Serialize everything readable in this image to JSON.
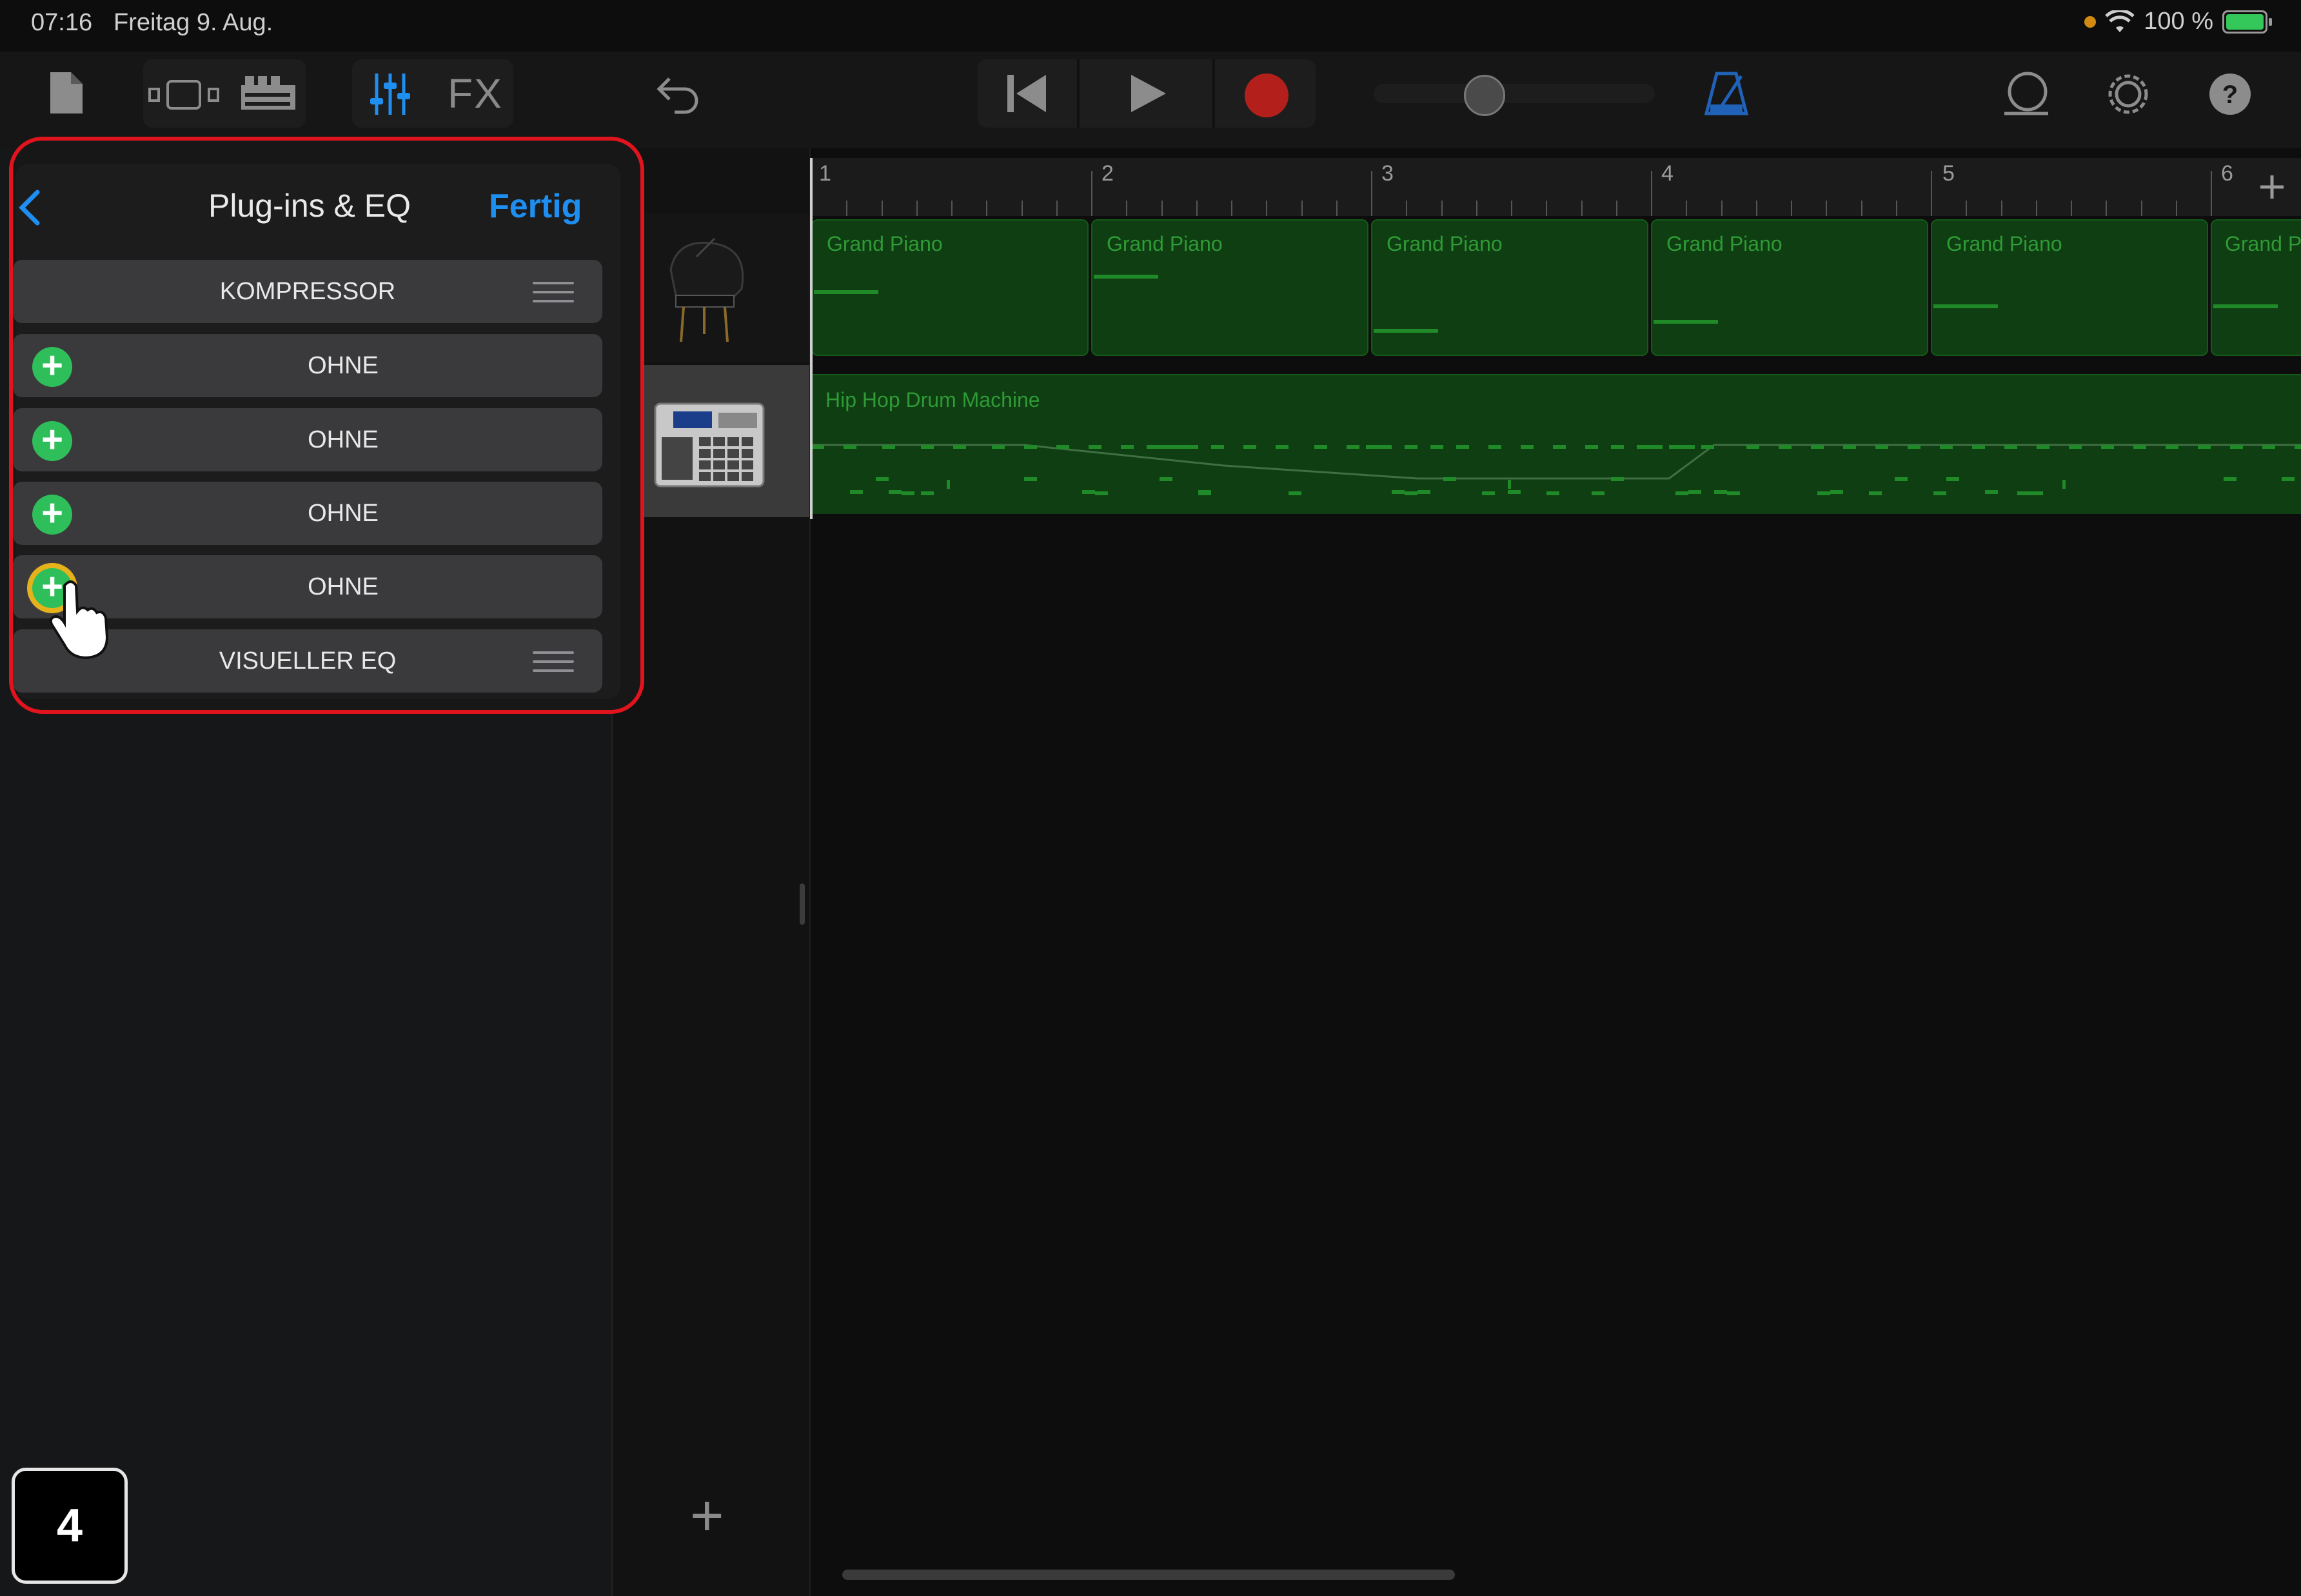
{
  "status_bar": {
    "time": "07:16",
    "date": "Freitag 9. Aug.",
    "battery_text": "100 %"
  },
  "popover": {
    "title": "Plug-ins & EQ",
    "done_label": "Fertig",
    "rows": [
      {
        "label": "KOMPRESSOR",
        "type": "plugin"
      },
      {
        "label": "OHNE",
        "type": "empty"
      },
      {
        "label": "OHNE",
        "type": "empty"
      },
      {
        "label": "OHNE",
        "type": "empty"
      },
      {
        "label": "OHNE",
        "type": "empty"
      },
      {
        "label": "VISUELLER EQ",
        "type": "plugin"
      }
    ]
  },
  "toolbar": {
    "fx_label": "FX"
  },
  "ruler": {
    "bars": [
      "1",
      "2",
      "3",
      "4",
      "5",
      "6"
    ]
  },
  "tracks": [
    {
      "name": "Grand Piano",
      "icon": "grand-piano-icon"
    },
    {
      "name": "Hip Hop Drum Machine",
      "icon": "drum-machine-icon"
    }
  ],
  "piano_regions": [
    {
      "label": "Grand Piano"
    },
    {
      "label": "Grand Piano"
    },
    {
      "label": "Grand Piano"
    },
    {
      "label": "Grand Piano"
    },
    {
      "label": "Grand Piano"
    },
    {
      "label": "Grand P"
    }
  ],
  "drum_region_label": "Hip Hop Drum Machine",
  "step_badge": "4",
  "colors": {
    "accent_blue": "#1f8ef1",
    "region_green": "#0e3e12",
    "record_red": "#b3201b",
    "highlight_red": "#e1141e",
    "add_green": "#2fbf5a"
  }
}
